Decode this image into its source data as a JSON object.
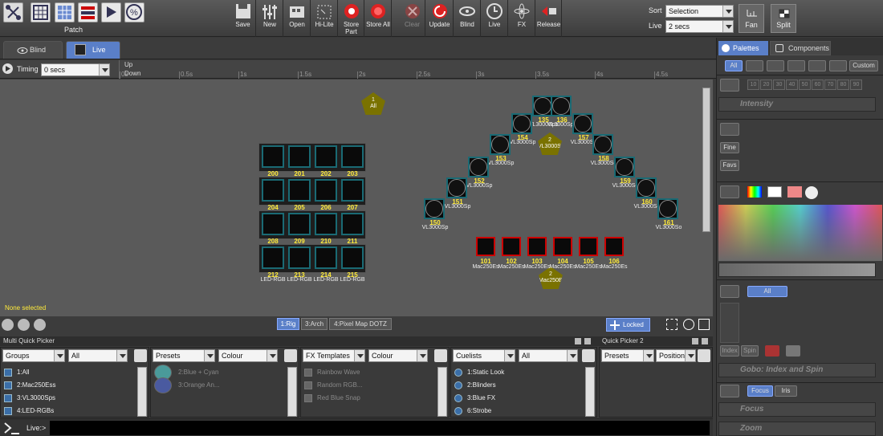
{
  "toolbar": {
    "patch_label": "Patch",
    "buttons": [
      "Save",
      "New",
      "Open",
      "Hi-Lite",
      "Store Part",
      "Store All",
      "Clear",
      "Update",
      "Blind",
      "Live",
      "FX",
      "Release"
    ],
    "sort_label": "Sort",
    "sort_value": "Selection",
    "live_label": "Live",
    "live_value": "2 secs",
    "fan_label": "Fan",
    "split_label": "Split"
  },
  "tabs": {
    "blind": "Blind",
    "live": "Live"
  },
  "timing": {
    "label": "Timing",
    "value": "0 secs",
    "up": "Up",
    "down": "Down",
    "ticks": [
      "0s",
      "0.5s",
      "1s",
      "1.5s",
      "2s",
      "2.5s",
      "3s",
      "3.5s",
      "4s",
      "4.5s"
    ]
  },
  "stage": {
    "none_selected": "None selected",
    "groups": [
      {
        "num": "1",
        "name": "All"
      },
      {
        "num": "2",
        "name": "VL3000Sps"
      },
      {
        "num": "2",
        "name": "Mac250Ess"
      }
    ],
    "led_numbers": [
      "200",
      "201",
      "202",
      "203",
      "204",
      "205",
      "206",
      "207",
      "208",
      "209",
      "210",
      "211",
      "212",
      "213",
      "214",
      "215"
    ],
    "led_names": [
      "LED-RGB",
      "LED-RGB",
      "LED-RGB",
      "LED-RGB"
    ],
    "vl_numbers": [
      "135",
      "136",
      "154",
      "157",
      "153",
      "158",
      "152",
      "159",
      "151",
      "160",
      "150",
      "161"
    ],
    "vl_name": "VL3000Sp",
    "vl_name_alt": "VL3000So",
    "vl_name_sps": "VL3000Sps",
    "mac_numbers": [
      "101",
      "102",
      "103",
      "104",
      "105",
      "106"
    ],
    "mac_name": "Mac250Ess",
    "mac_name_short": "Mac250Es",
    "layout_tabs": [
      "1:Rig",
      "3:Arch",
      "4:Pixel Map DOTZ"
    ],
    "locked": "Locked"
  },
  "bottom": {
    "multi_title": "Multi Quick Picker",
    "qp2_title": "Quick Picker 2",
    "col1_type": "Groups",
    "col1_filter": "All",
    "col1_items": [
      "1:All",
      "2:Mac250Ess",
      "3:VL3000Sps",
      "4:LED-RGBs"
    ],
    "col2_type": "Presets",
    "col2_filter": "Colour",
    "col2_items": [
      "2:Blue + Cyan",
      "3:Orange An..."
    ],
    "col3_type": "FX Templates",
    "col3_filter": "Colour",
    "col3_items": [
      "Rainbow Wave",
      "Random RGB...",
      "Red Blue Snap"
    ],
    "col4_type": "Cuelists",
    "col4_filter": "All",
    "col4_items": [
      "1:Static Look",
      "2:Blinders",
      "3:Blue FX",
      "6:Strobe"
    ],
    "col5_type": "Presets",
    "col5_filter": "Position",
    "cmd_prompt": "Live:>"
  },
  "right": {
    "tabs": [
      "Palettes",
      "Components"
    ],
    "filter_all": "All",
    "filter_custom": "Custom",
    "intensity_steps": [
      "10",
      "20",
      "30",
      "40",
      "50",
      "60",
      "70",
      "80",
      "90"
    ],
    "intensity": "Intensity",
    "fine": "Fine",
    "favs": "Favs",
    "gobo_all": "All",
    "index": "Index",
    "spin": "Spin",
    "gobo_label": "Gobo: Index and Spin",
    "focus_tab": "Focus",
    "iris_tab": "Iris",
    "focus": "Focus",
    "zoom": "Zoom"
  }
}
